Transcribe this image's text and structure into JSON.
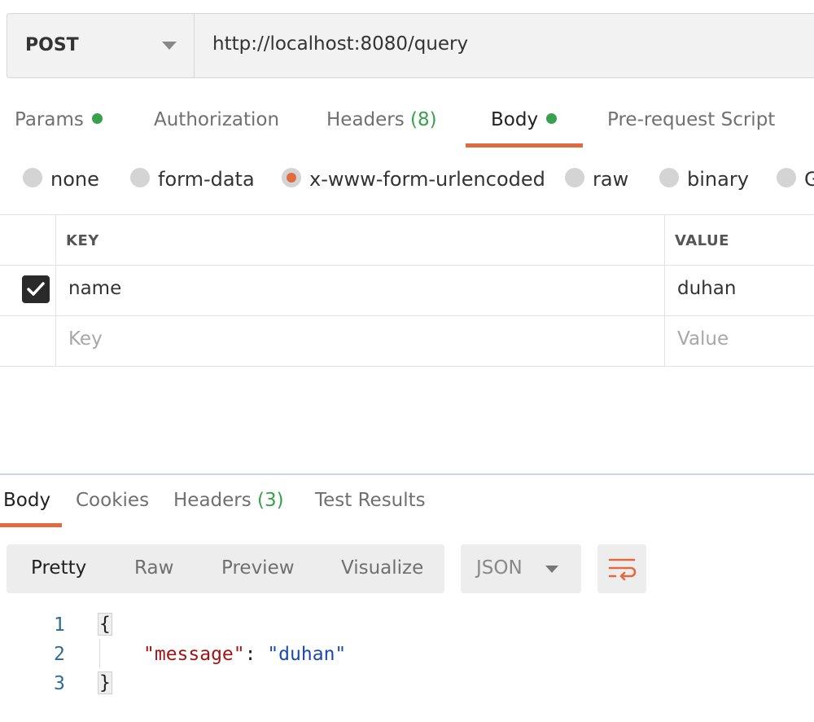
{
  "request": {
    "method": "POST",
    "url": "http://localhost:8080/query",
    "tabs": [
      {
        "label": "Params",
        "dot": true
      },
      {
        "label": "Authorization"
      },
      {
        "label": "Headers",
        "count": "(8)"
      },
      {
        "label": "Body",
        "dot": true,
        "active": true
      },
      {
        "label": "Pre-request Script"
      }
    ],
    "body_types": [
      "none",
      "form-data",
      "x-www-form-urlencoded",
      "raw",
      "binary",
      "G"
    ],
    "selected_body_type": "x-www-form-urlencoded",
    "table": {
      "key_header": "KEY",
      "value_header": "VALUE",
      "rows": [
        {
          "checked": true,
          "key": "name",
          "value": "duhan"
        }
      ],
      "key_placeholder": "Key",
      "value_placeholder": "Value"
    }
  },
  "response": {
    "tabs": [
      {
        "label": "Body",
        "active": true
      },
      {
        "label": "Cookies"
      },
      {
        "label": "Headers",
        "count": "(3)"
      },
      {
        "label": "Test Results"
      }
    ],
    "view_modes": [
      "Pretty",
      "Raw",
      "Preview",
      "Visualize"
    ],
    "active_view": "Pretty",
    "format": "JSON",
    "code": {
      "line_numbers": [
        "1",
        "2",
        "3"
      ],
      "open_brace": "{",
      "json_key": "\"message\"",
      "colon": ": ",
      "json_value": "\"duhan\"",
      "close_brace": "}"
    }
  },
  "colors": {
    "accent": "#e26a3f",
    "indicator": "#37a14e"
  },
  "icons": {
    "method_dropdown": "caret-down-icon",
    "checkbox": "checkmark-icon",
    "wrap": "wrap-lines-icon"
  }
}
